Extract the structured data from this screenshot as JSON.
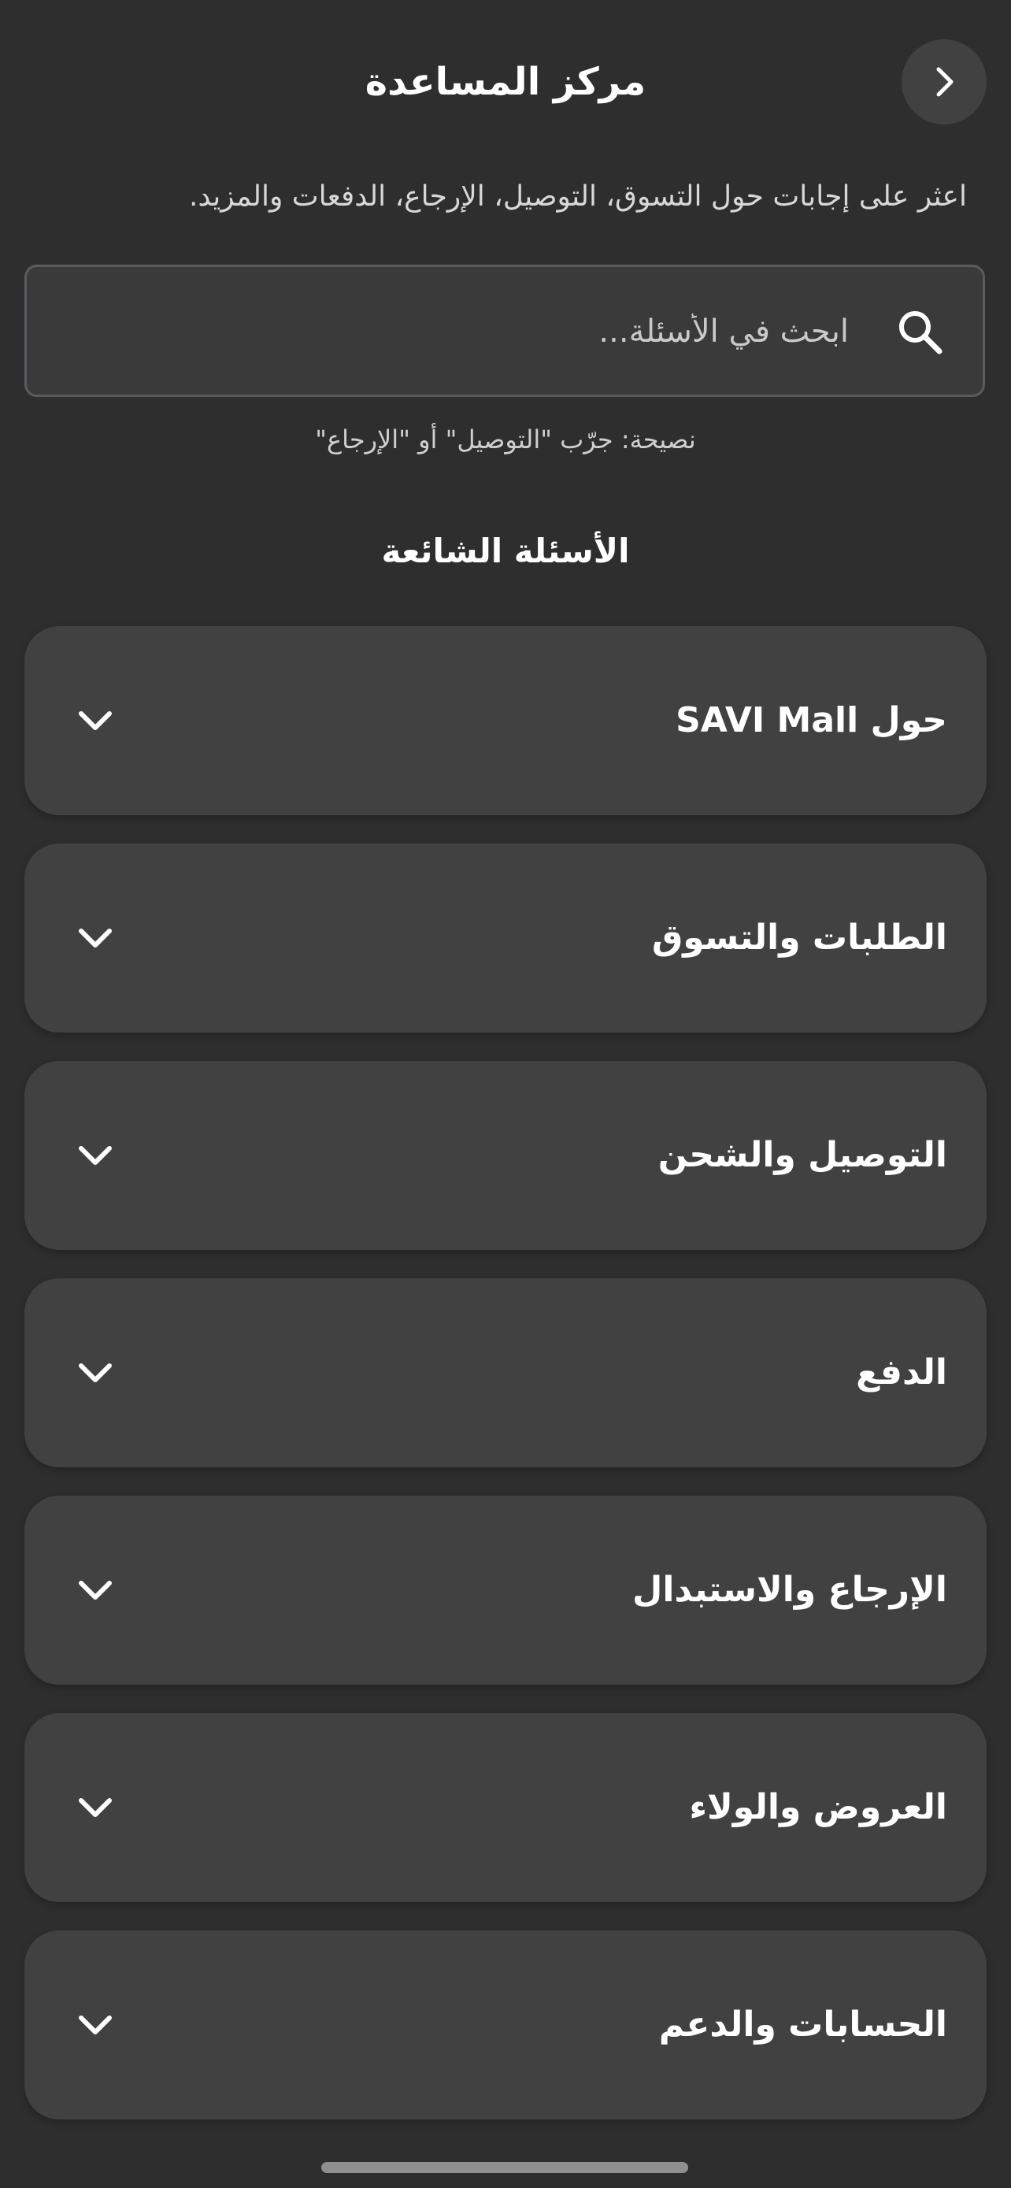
{
  "header": {
    "title": "مركز المساعدة",
    "back_icon": "chevron-right-icon"
  },
  "subtitle": "اعثر على إجابات حول التسوق، التوصيل، الإرجاع، الدفعات والمزيد.",
  "search": {
    "placeholder": "ابحث في الأسئلة...",
    "value": "",
    "icon": "search-icon"
  },
  "tip": "نصيحة: جرّب \"التوصيل\" أو \"الإرجاع\"",
  "faq": {
    "section_title": "الأسئلة الشائعة",
    "chevron_icon": "chevron-down-icon",
    "items": [
      {
        "label": "حول SAVI Mall"
      },
      {
        "label": "الطلبات والتسوق"
      },
      {
        "label": "التوصيل والشحن"
      },
      {
        "label": "الدفع"
      },
      {
        "label": "الإرجاع والاستبدال"
      },
      {
        "label": "العروض والولاء"
      },
      {
        "label": "الحسابات والدعم"
      }
    ]
  },
  "colors": {
    "background": "#2e2e2e",
    "card": "#414141",
    "text": "#ffffff",
    "muted_text": "#cfcfcf",
    "search_border": "#5b5b5f"
  }
}
